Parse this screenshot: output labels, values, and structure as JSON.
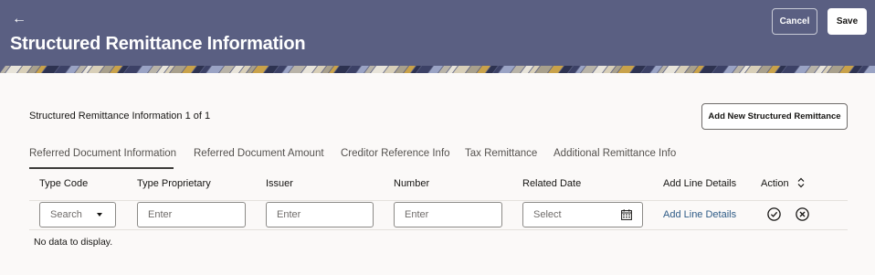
{
  "header": {
    "back_icon": "arrow-left-icon",
    "title": "Structured Remittance Information",
    "cancel_label": "Cancel",
    "save_label": "Save",
    "bg_color": "#5a5f82"
  },
  "section": {
    "count_text": "Structured Remittance Information 1 of 1",
    "add_button_label": "Add New Structured Remittance"
  },
  "tabs": [
    {
      "label": "Referred Document Information",
      "active": true
    },
    {
      "label": "Referred Document Amount",
      "active": false
    },
    {
      "label": "Creditor Reference Info",
      "active": false
    },
    {
      "label": "Tax Remittance",
      "active": false
    },
    {
      "label": "Additional Remittance Info",
      "active": false
    }
  ],
  "table": {
    "columns": [
      "Type Code",
      "Type Proprietary",
      "Issuer",
      "Number",
      "Related Date",
      "Add Line Details",
      "Action"
    ],
    "row": {
      "type_code_placeholder": "Search",
      "type_proprietary_placeholder": "Enter",
      "issuer_placeholder": "Enter",
      "number_placeholder": "Enter",
      "related_date_placeholder": "Select",
      "add_line_link": "Add Line Details",
      "action_icons": [
        "check-circle-icon",
        "close-circle-icon"
      ]
    },
    "empty_message": "No data to display."
  }
}
